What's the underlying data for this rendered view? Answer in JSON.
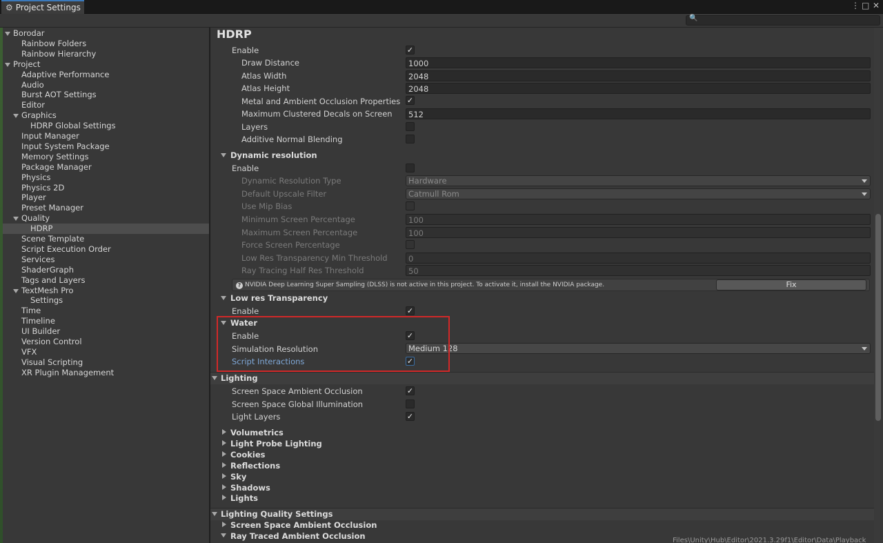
{
  "window": {
    "tab_title": "Project Settings",
    "search_placeholder": ""
  },
  "sidebar": {
    "items": [
      {
        "label": "Borodar",
        "level": 0,
        "expanded": true
      },
      {
        "label": "Rainbow Folders",
        "level": 1
      },
      {
        "label": "Rainbow Hierarchy",
        "level": 1
      },
      {
        "label": "Project",
        "level": 0,
        "expanded": true
      },
      {
        "label": "Adaptive Performance",
        "level": 1
      },
      {
        "label": "Audio",
        "level": 1
      },
      {
        "label": "Burst AOT Settings",
        "level": 1
      },
      {
        "label": "Editor",
        "level": 1
      },
      {
        "label": "Graphics",
        "level": 1,
        "expanded": true
      },
      {
        "label": "HDRP Global Settings",
        "level": 2
      },
      {
        "label": "Input Manager",
        "level": 1
      },
      {
        "label": "Input System Package",
        "level": 1
      },
      {
        "label": "Memory Settings",
        "level": 1
      },
      {
        "label": "Package Manager",
        "level": 1
      },
      {
        "label": "Physics",
        "level": 1
      },
      {
        "label": "Physics 2D",
        "level": 1
      },
      {
        "label": "Player",
        "level": 1
      },
      {
        "label": "Preset Manager",
        "level": 1
      },
      {
        "label": "Quality",
        "level": 1,
        "expanded": true
      },
      {
        "label": "HDRP",
        "level": 2,
        "selected": true
      },
      {
        "label": "Scene Template",
        "level": 1
      },
      {
        "label": "Script Execution Order",
        "level": 1
      },
      {
        "label": "Services",
        "level": 1
      },
      {
        "label": "ShaderGraph",
        "level": 1
      },
      {
        "label": "Tags and Layers",
        "level": 1
      },
      {
        "label": "TextMesh Pro",
        "level": 1,
        "expanded": true
      },
      {
        "label": "Settings",
        "level": 2
      },
      {
        "label": "Time",
        "level": 1
      },
      {
        "label": "Timeline",
        "level": 1
      },
      {
        "label": "UI Builder",
        "level": 1
      },
      {
        "label": "Version Control",
        "level": 1
      },
      {
        "label": "VFX",
        "level": 1
      },
      {
        "label": "Visual Scripting",
        "level": 1
      },
      {
        "label": "XR Plugin Management",
        "level": 1
      }
    ]
  },
  "main": {
    "title": "HDRP",
    "decals": {
      "enable_label": "Enable",
      "enable": true,
      "draw_distance_label": "Draw Distance",
      "draw_distance": "1000",
      "atlas_width_label": "Atlas Width",
      "atlas_width": "2048",
      "atlas_height_label": "Atlas Height",
      "atlas_height": "2048",
      "metal_ao_label": "Metal and Ambient Occlusion Properties",
      "metal_ao": true,
      "max_clustered_label": "Maximum Clustered Decals on Screen",
      "max_clustered": "512",
      "layers_label": "Layers",
      "layers": false,
      "additive_label": "Additive Normal Blending",
      "additive": false
    },
    "dynamic_resolution": {
      "header": "Dynamic resolution",
      "enable_label": "Enable",
      "enable": false,
      "type_label": "Dynamic Resolution Type",
      "type": "Hardware",
      "upscale_label": "Default Upscale Filter",
      "upscale": "Catmull Rom",
      "mip_bias_label": "Use Mip Bias",
      "min_pct_label": "Minimum Screen Percentage",
      "min_pct": "100",
      "max_pct_label": "Maximum Screen Percentage",
      "max_pct": "100",
      "force_label": "Force Screen Percentage",
      "lowres_thresh_label": "Low Res Transparency Min Threshold",
      "lowres_thresh": "0",
      "rt_half_label": "Ray Tracing Half Res Threshold",
      "rt_half": "50",
      "dlss_message": "NVIDIA Deep Learning Super Sampling (DLSS) is not active in this project. To activate it, install the NVIDIA package.",
      "fix_label": "Fix"
    },
    "low_res_transparency": {
      "header": "Low res Transparency",
      "enable_label": "Enable",
      "enable": true
    },
    "water": {
      "header": "Water",
      "enable_label": "Enable",
      "enable": true,
      "sim_res_label": "Simulation Resolution",
      "sim_res": "Medium 128",
      "script_label": "Script Interactions",
      "script": true
    },
    "lighting": {
      "header": "Lighting",
      "ssao_label": "Screen Space Ambient Occlusion",
      "ssao": true,
      "ssgi_label": "Screen Space Global Illumination",
      "ssgi": false,
      "light_layers_label": "Light Layers",
      "light_layers": true,
      "subsections": [
        "Volumetrics",
        "Light Probe Lighting",
        "Cookies",
        "Reflections",
        "Sky",
        "Shadows",
        "Lights"
      ]
    },
    "lighting_quality": {
      "header": "Lighting Quality Settings",
      "ssao": "Screen Space Ambient Occlusion",
      "rtao": "Ray Traced Ambient Occlusion"
    }
  },
  "footer_path": "Files\\Unity\\Hub\\Editor\\2021.3.29f1\\Editor\\Data\\Playback"
}
